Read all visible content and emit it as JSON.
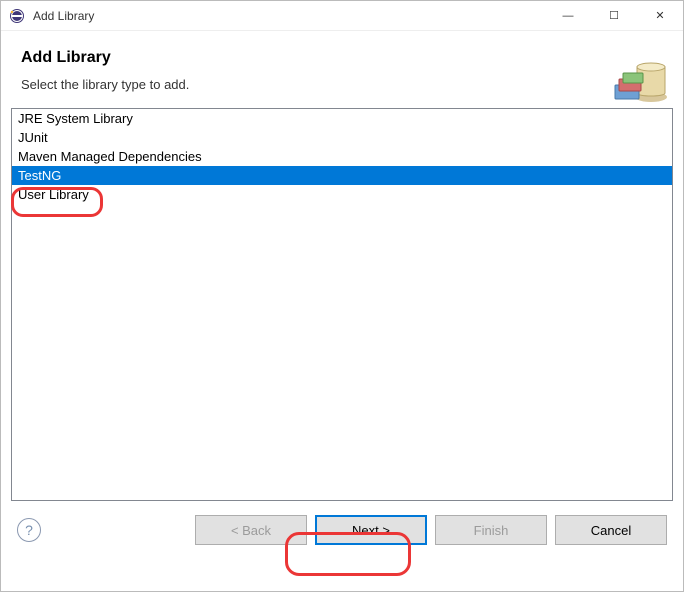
{
  "window": {
    "title": "Add Library"
  },
  "header": {
    "title": "Add Library",
    "subtitle": "Select the library type to add."
  },
  "list": {
    "items": [
      {
        "label": "JRE System Library",
        "selected": false
      },
      {
        "label": "JUnit",
        "selected": false
      },
      {
        "label": "Maven Managed Dependencies",
        "selected": false
      },
      {
        "label": "TestNG",
        "selected": true
      },
      {
        "label": "User Library",
        "selected": false
      }
    ]
  },
  "buttons": {
    "help": "?",
    "back": "< Back",
    "next": "Next >",
    "finish": "Finish",
    "cancel": "Cancel"
  },
  "win_controls": {
    "minimize": "—",
    "maximize": "☐",
    "close": "✕"
  }
}
